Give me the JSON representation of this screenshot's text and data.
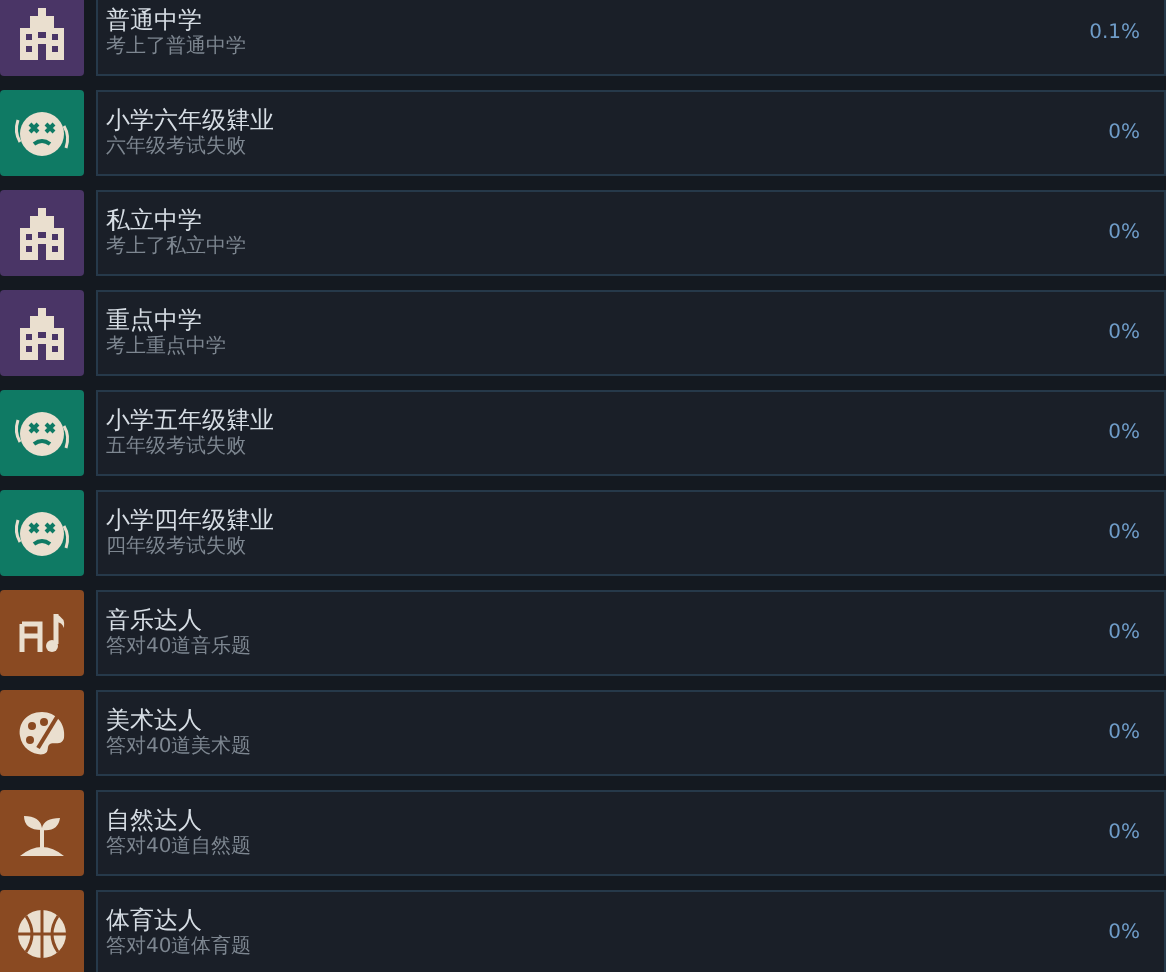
{
  "achievements": [
    {
      "kind": "school",
      "color": "#4a3566",
      "title": "普通中学",
      "description": "考上了普通中学",
      "percent": "0.1%"
    },
    {
      "kind": "dizzy",
      "color": "#0f7a64",
      "title": "小学六年级肄业",
      "description": "六年级考试失败",
      "percent": "0%"
    },
    {
      "kind": "school",
      "color": "#4a3566",
      "title": "私立中学",
      "description": "考上了私立中学",
      "percent": "0%"
    },
    {
      "kind": "school",
      "color": "#4a3566",
      "title": "重点中学",
      "description": "考上重点中学",
      "percent": "0%"
    },
    {
      "kind": "dizzy",
      "color": "#0f7a64",
      "title": "小学五年级肄业",
      "description": "五年级考试失败",
      "percent": "0%"
    },
    {
      "kind": "dizzy",
      "color": "#0f7a64",
      "title": "小学四年级肄业",
      "description": "四年级考试失败",
      "percent": "0%"
    },
    {
      "kind": "music",
      "color": "#8a4a22",
      "title": "音乐达人",
      "description": "答对40道音乐题",
      "percent": "0%"
    },
    {
      "kind": "palette",
      "color": "#8a4a22",
      "title": "美术达人",
      "description": "答对40道美术题",
      "percent": "0%"
    },
    {
      "kind": "sprout",
      "color": "#8a4a22",
      "title": "自然达人",
      "description": "答对40道自然题",
      "percent": "0%"
    },
    {
      "kind": "ball",
      "color": "#8a4a22",
      "title": "体育达人",
      "description": "答对40道体育题",
      "percent": "0%"
    }
  ]
}
